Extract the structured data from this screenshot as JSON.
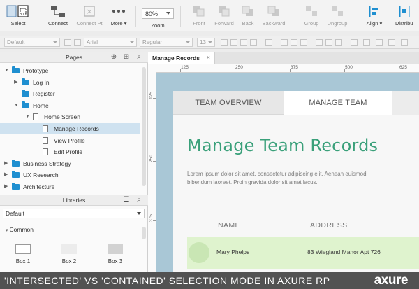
{
  "toolbar": {
    "select": "Select",
    "connect": "Connect",
    "connect_pt": "Connect Pt",
    "more": "More",
    "zoom_value": "80%",
    "zoom_label": "Zoom",
    "front": "Front",
    "forward": "Forward",
    "back": "Back",
    "backward": "Backward",
    "group": "Group",
    "ungroup": "Ungroup",
    "align": "Align",
    "distribute": "Distribu"
  },
  "formatbar": {
    "style": "Default",
    "font": "Arial",
    "weight": "Regular",
    "size": "13"
  },
  "pages_panel": {
    "title": "Pages",
    "items": [
      {
        "label": "Prototype",
        "type": "folder",
        "expanded": true,
        "level": 0
      },
      {
        "label": "Log In",
        "type": "folder",
        "expanded": false,
        "level": 1
      },
      {
        "label": "Register",
        "type": "folder",
        "level": 1
      },
      {
        "label": "Home",
        "type": "folder",
        "expanded": true,
        "level": 1
      },
      {
        "label": "Home Screen",
        "type": "page",
        "expanded": true,
        "level": 2
      },
      {
        "label": "Manage Records",
        "type": "page",
        "level": 3,
        "selected": true
      },
      {
        "label": "View Profile",
        "type": "page",
        "level": 3
      },
      {
        "label": "Edit Profile",
        "type": "page",
        "level": 3
      },
      {
        "label": "Business Strategy",
        "type": "folder",
        "expanded": false,
        "level": 0
      },
      {
        "label": "UX Research",
        "type": "folder",
        "expanded": false,
        "level": 0
      },
      {
        "label": "Architecture",
        "type": "folder",
        "expanded": false,
        "level": 0
      }
    ]
  },
  "libraries_panel": {
    "title": "Libraries",
    "selected_library": "Default",
    "section": "Common",
    "widgets": [
      "Box 1",
      "Box 2",
      "Box 3"
    ]
  },
  "document": {
    "tab_title": "Manage Records",
    "ruler_h": [
      "125",
      "250",
      "375",
      "500",
      "625"
    ],
    "ruler_v": [
      "125",
      "250",
      "375"
    ]
  },
  "artboard": {
    "tabs": [
      "TEAM OVERVIEW",
      "MANAGE TEAM"
    ],
    "heading": "Manage Team Records",
    "lorem": "Lorem ipsum dolor sit amet, consectetur adipiscing elit. Aenean euismod bibendum laoreet. Proin gravida dolor sit amet lacus.",
    "columns": [
      "NAME",
      "ADDRESS"
    ],
    "row": {
      "name": "Mary Phelps",
      "address": "83 Wiegland Manor Apt 726"
    }
  },
  "caption": "'INTERSECTED' VS 'CONTAINED' SELECTION MODE IN AXURE RP",
  "logo": "axure",
  "colors": {
    "accent": "#3aa07a",
    "folder": "#1f8fd0",
    "canvas_bg": "#a9c7d6",
    "row_highlight": "#dff3ce"
  }
}
